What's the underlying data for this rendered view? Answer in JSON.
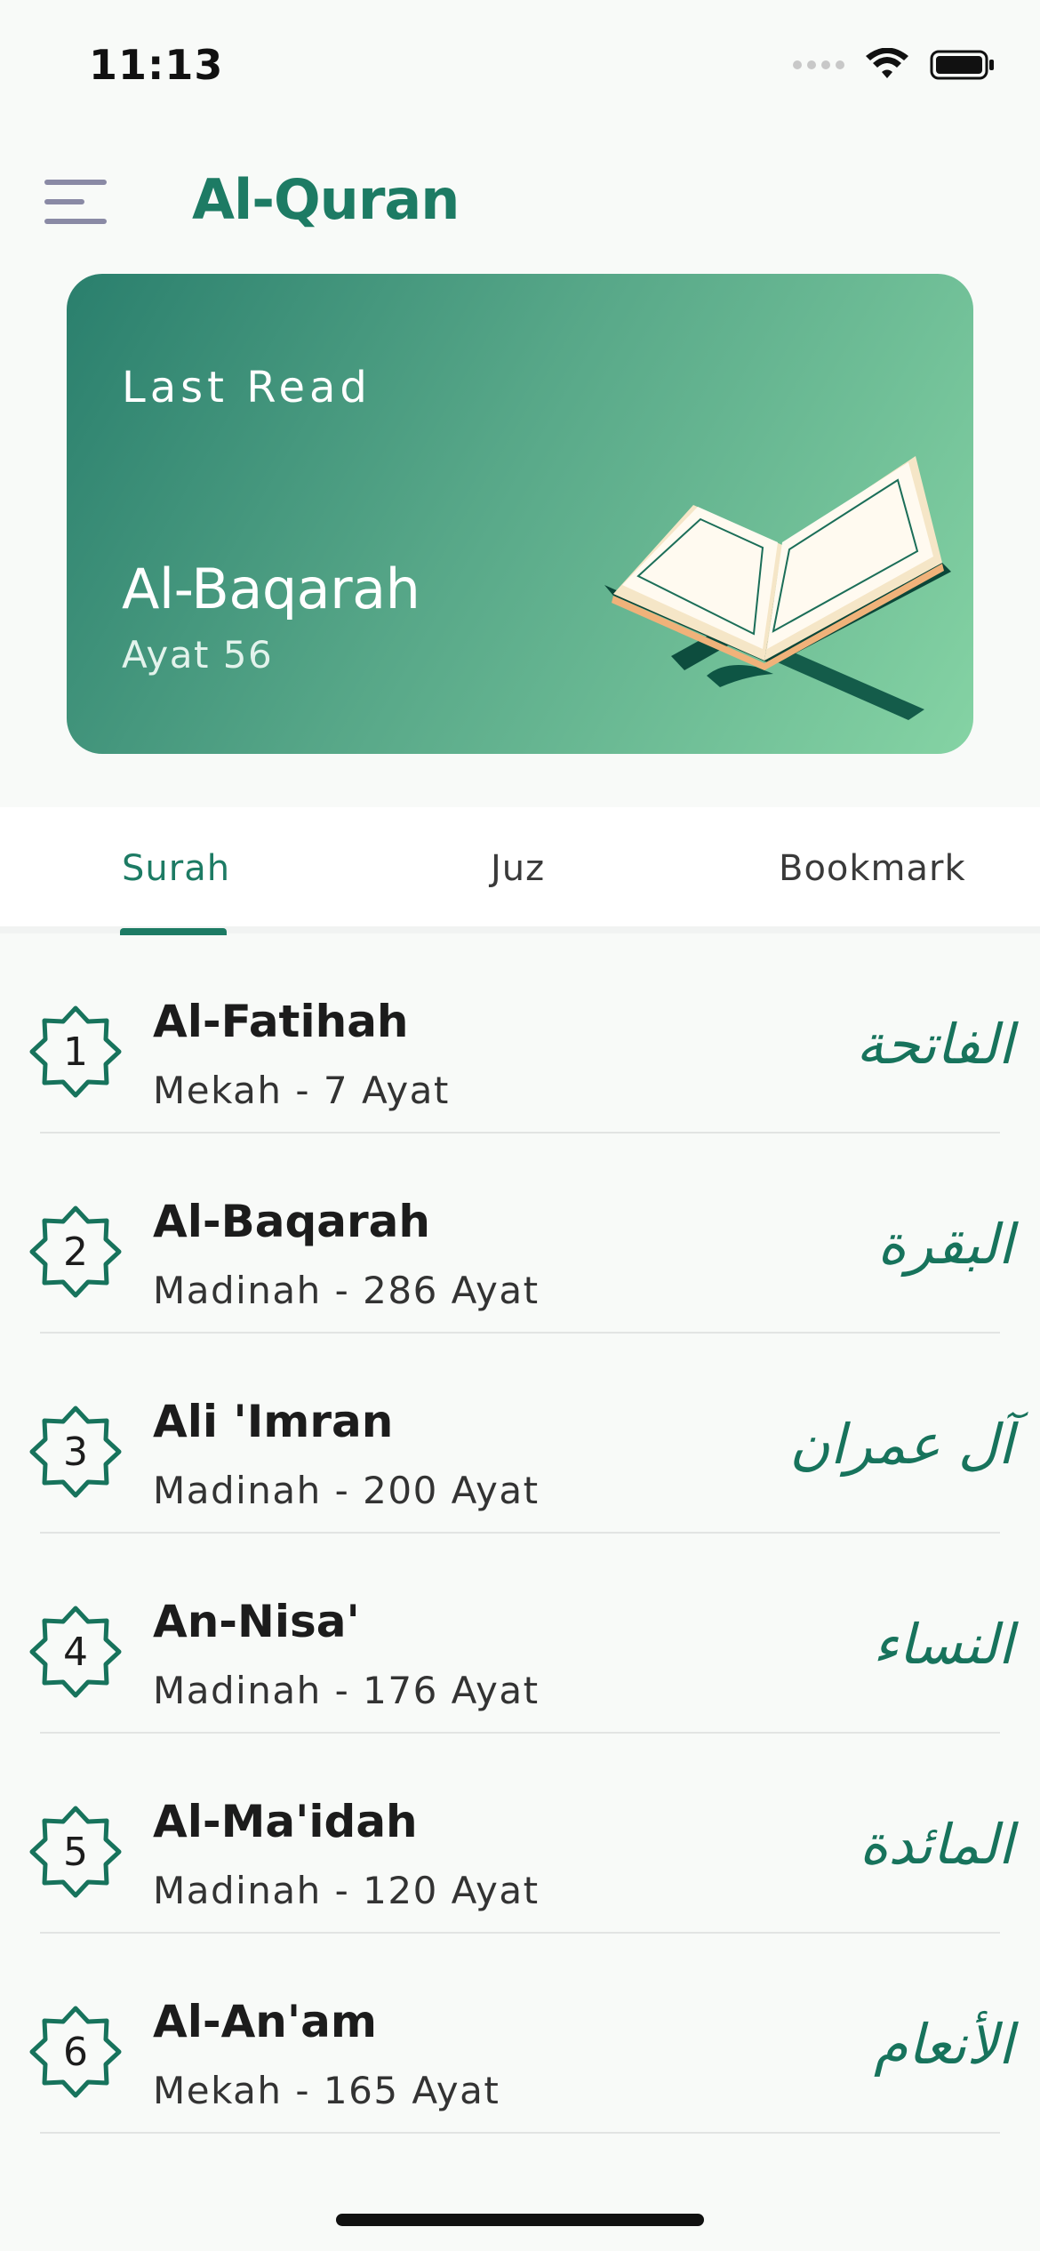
{
  "status_bar": {
    "time": "11:13",
    "signal_icon": "cellular-dots-icon",
    "wifi_icon": "wifi-icon",
    "battery_icon": "battery-icon"
  },
  "app_bar": {
    "menu_icon": "hamburger-menu-icon",
    "title": "Al-Quran"
  },
  "last_read": {
    "label": "Last Read",
    "surah": "Al-Baqarah",
    "ayat": "Ayat 56",
    "illustration": "open-quran-on-stand-icon"
  },
  "tabs": [
    {
      "label": "Surah",
      "active": true
    },
    {
      "label": "Juz",
      "active": false
    },
    {
      "label": "Bookmark",
      "active": false
    }
  ],
  "surahs": [
    {
      "number": "1",
      "name": "Al-Fatihah",
      "meta": "Mekah - 7 Ayat",
      "arabic": "الفاتحة"
    },
    {
      "number": "2",
      "name": "Al-Baqarah",
      "meta": "Madinah - 286 Ayat",
      "arabic": "البقرة"
    },
    {
      "number": "3",
      "name": "Ali 'Imran",
      "meta": "Madinah - 200 Ayat",
      "arabic": "آل عمران"
    },
    {
      "number": "4",
      "name": "An-Nisa'",
      "meta": "Madinah - 176 Ayat",
      "arabic": "النساء"
    },
    {
      "number": "5",
      "name": "Al-Ma'idah",
      "meta": "Madinah - 120 Ayat",
      "arabic": "المائدة"
    },
    {
      "number": "6",
      "name": "Al-An'am",
      "meta": "Mekah - 165 Ayat",
      "arabic": "الأنعام"
    }
  ],
  "colors": {
    "primary": "#1d7b64",
    "card_start": "#2a7f6d",
    "card_end": "#85d3a4",
    "menu_icon": "#8a8aa5"
  }
}
